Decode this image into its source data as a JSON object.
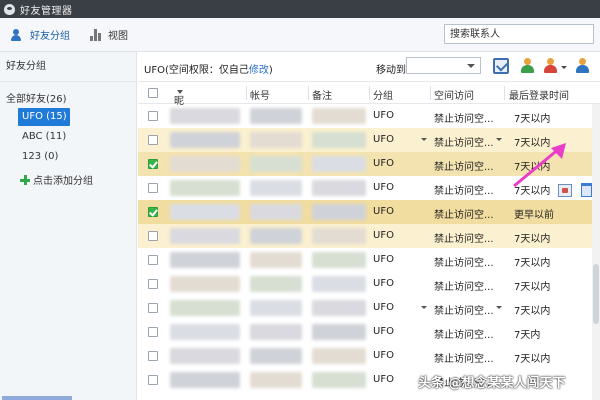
{
  "window": {
    "title": "好友管理器"
  },
  "toolbar": {
    "friends_group_label": "好友分组",
    "view_label": "视图",
    "search_placeholder": "搜索联系人"
  },
  "sidebar": {
    "header": "好友分组",
    "all_friends": "全部好友(26)",
    "groups": [
      {
        "label": "UFO (15)",
        "selected": true
      },
      {
        "label": "ABC (11)",
        "selected": false
      },
      {
        "label": "123 (0)",
        "selected": false
      }
    ],
    "add_group": "点击添加分组"
  },
  "main": {
    "permission_prefix": "UFO(空间权限：仅自己",
    "permission_link": "修改",
    "permission_suffix": ")",
    "move_to_label": "移动到",
    "columns": {
      "nickname": "昵称",
      "account": "帐号",
      "remark": "备注",
      "group": "分组",
      "space_access": "空间访问",
      "last_login": "最后登录时间"
    },
    "rows": [
      {
        "checked": false,
        "group": "UFO",
        "space_access": "禁止访问空...",
        "last_login": "7天以内",
        "style": "",
        "dropdowns": false
      },
      {
        "checked": false,
        "group": "UFO",
        "space_access": "禁止访问空...",
        "last_login": "7天以内",
        "style": "hl",
        "dropdowns": true
      },
      {
        "checked": true,
        "group": "UFO",
        "space_access": "禁止访问空...",
        "last_login": "7天以内",
        "style": "hl2",
        "dropdowns": false
      },
      {
        "checked": false,
        "group": "UFO",
        "space_access": "禁止访问空...",
        "last_login": "7天以内",
        "style": "",
        "dropdowns": false
      },
      {
        "checked": true,
        "group": "UFO",
        "space_access": "禁止访问空...",
        "last_login": "更早以前",
        "style": "sel",
        "dropdowns": false
      },
      {
        "checked": false,
        "group": "UFO",
        "space_access": "禁止访问空...",
        "last_login": "7天以内",
        "style": "hl",
        "dropdowns": false
      },
      {
        "checked": false,
        "group": "UFO",
        "space_access": "禁止访问空...",
        "last_login": "7天以内",
        "style": "",
        "dropdowns": false
      },
      {
        "checked": false,
        "group": "UFO",
        "space_access": "禁止访问空...",
        "last_login": "7天以内",
        "style": "",
        "dropdowns": false
      },
      {
        "checked": false,
        "group": "UFO",
        "space_access": "禁止访问空...",
        "last_login": "7天以内",
        "style": "",
        "dropdowns": true
      },
      {
        "checked": false,
        "group": "UFO",
        "space_access": "禁止访问空...",
        "last_login": "7天内",
        "style": "",
        "dropdowns": false
      },
      {
        "checked": false,
        "group": "UFO",
        "space_access": "禁止访问空...",
        "last_login": "7天以内",
        "style": "",
        "dropdowns": false
      },
      {
        "checked": false,
        "group": "UFO",
        "space_access": "禁止访问空...",
        "last_login": "",
        "style": "",
        "dropdowns": false
      }
    ]
  },
  "watermark": "头条 @想念某某人闯天下",
  "colors": {
    "accent": "#1f7ad8",
    "highlight": "#fbf0cf",
    "arrow": "#e83ec9",
    "check": "#39b54a"
  }
}
